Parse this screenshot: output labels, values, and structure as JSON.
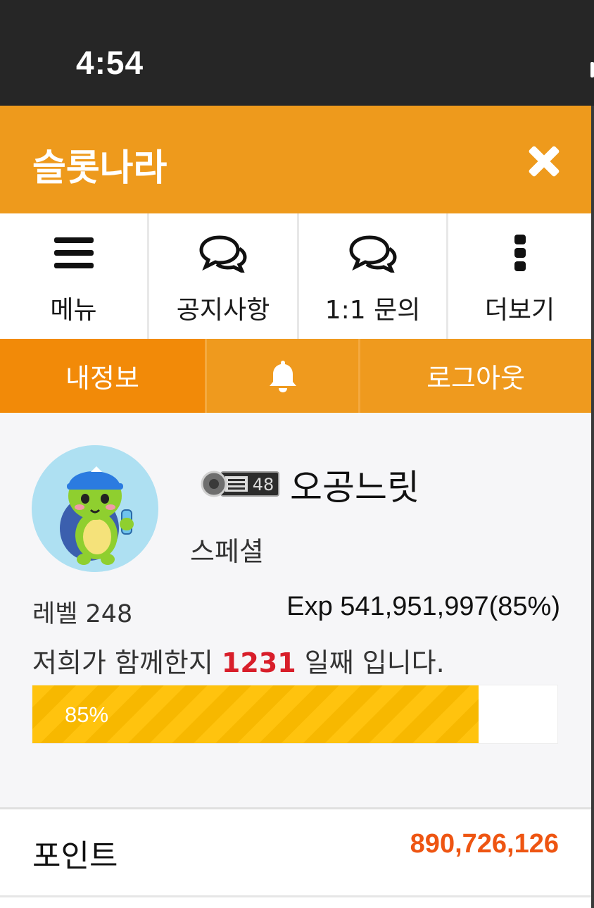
{
  "status_bar": {
    "time": "4:54"
  },
  "header": {
    "title": "슬롯나라",
    "close_icon": "close-icon"
  },
  "nav": [
    {
      "label": "메뉴",
      "icon": "hamburger-menu-icon"
    },
    {
      "label": "공지사항",
      "icon": "chat-bubbles-icon"
    },
    {
      "label": "1:1 문의",
      "icon": "chat-bubbles-icon"
    },
    {
      "label": "더보기",
      "icon": "more-vertical-icon"
    }
  ],
  "tabs": [
    {
      "label": "내정보",
      "active": true
    },
    {
      "label": "",
      "icon": "bell-icon"
    },
    {
      "label": "로그아웃"
    }
  ],
  "profile": {
    "badge_text": "48",
    "nickname": "오공느릿",
    "grade": "스페셜",
    "level_label": "레벨 248",
    "exp_label": "Exp 541,951,997(85%)",
    "days_prefix": "저희가 함께한지 ",
    "days_count": "1231",
    "days_suffix": " 일째 입니다.",
    "progress_label": "85%",
    "progress_value": 85
  },
  "points": {
    "label": "포인트",
    "value": "890,726,126"
  },
  "colors": {
    "header": "#ee9a1c",
    "tab_active": "#f28a08",
    "points_value": "#ee5512",
    "days_highlight": "#d81e2a",
    "progress": "#ffc30e"
  }
}
